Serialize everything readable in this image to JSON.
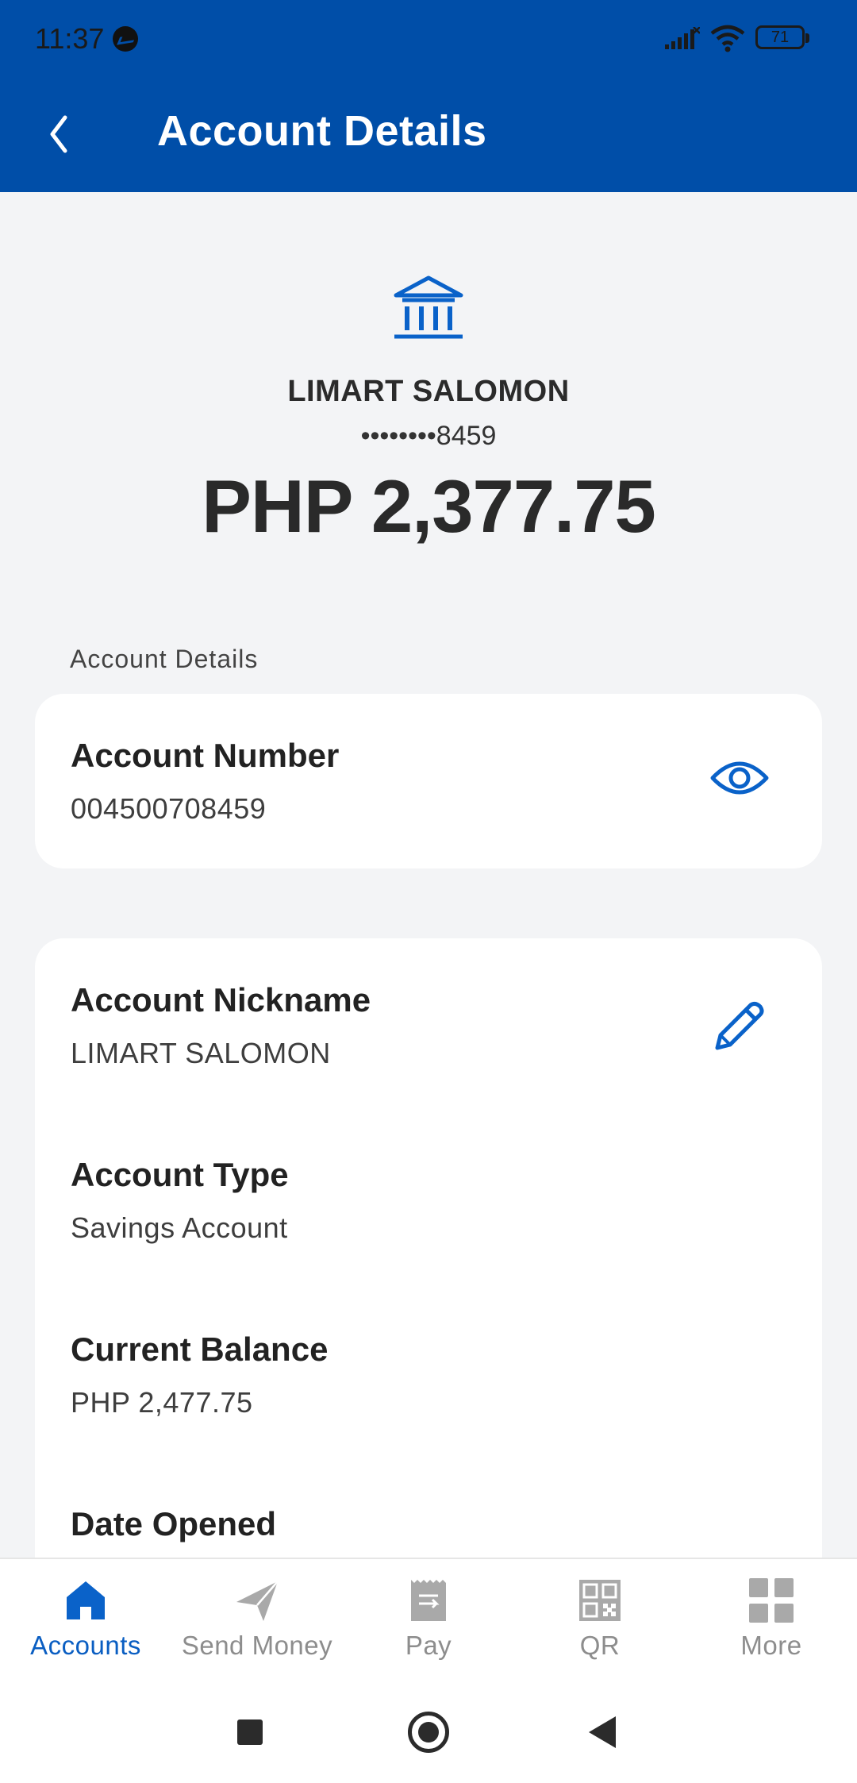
{
  "status_bar": {
    "time": "11:37",
    "battery": "71"
  },
  "header": {
    "title": "Account Details",
    "back_icon": "chevron-left-icon"
  },
  "account": {
    "icon": "bank-icon",
    "name": "LIMART SALOMON",
    "masked_number": "••••••••8459",
    "balance": "PHP 2,377.75"
  },
  "section_label": "Account Details",
  "account_number": {
    "label": "Account Number",
    "value": "004500708459",
    "icon": "eye-icon"
  },
  "details": [
    {
      "label": "Account Nickname",
      "value": "LIMART SALOMON",
      "icon": "pencil-icon"
    },
    {
      "label": "Account Type",
      "value": "Savings Account"
    },
    {
      "label": "Current Balance",
      "value": "PHP 2,477.75"
    },
    {
      "label": "Date Opened",
      "value": ""
    }
  ],
  "bottom_nav": [
    {
      "label": "Accounts",
      "icon": "home-icon",
      "active": true
    },
    {
      "label": "Send Money",
      "icon": "paper-plane-icon",
      "active": false
    },
    {
      "label": "Pay",
      "icon": "receipt-icon",
      "active": false
    },
    {
      "label": "QR",
      "icon": "qr-code-icon",
      "active": false
    },
    {
      "label": "More",
      "icon": "grid-icon",
      "active": false
    }
  ],
  "colors": {
    "brand_blue": "#004ea8",
    "accent_blue": "#0a5ec2",
    "background": "#f3f4f6",
    "inactive": "#8d8d8d"
  }
}
